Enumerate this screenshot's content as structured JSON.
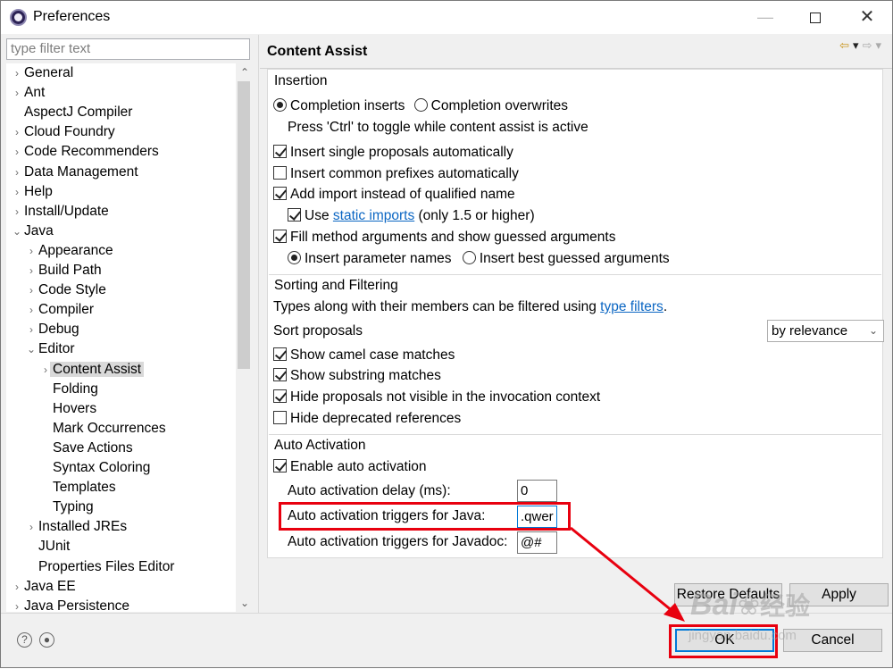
{
  "window": {
    "title": "Preferences"
  },
  "left": {
    "filter_placeholder": "type filter text",
    "tree": [
      {
        "label": "General",
        "twisty": "›"
      },
      {
        "label": "Ant",
        "twisty": "›"
      },
      {
        "label": "AspectJ Compiler",
        "twisty": ""
      },
      {
        "label": "Cloud Foundry",
        "twisty": "›"
      },
      {
        "label": "Code Recommenders",
        "twisty": "›"
      },
      {
        "label": "Data Management",
        "twisty": "›"
      },
      {
        "label": "Help",
        "twisty": "›"
      },
      {
        "label": "Install/Update",
        "twisty": "›"
      },
      {
        "label": "Java",
        "twisty": "⌄"
      },
      {
        "label": "Appearance",
        "twisty": "›"
      },
      {
        "label": "Build Path",
        "twisty": "›"
      },
      {
        "label": "Code Style",
        "twisty": "›"
      },
      {
        "label": "Compiler",
        "twisty": "›"
      },
      {
        "label": "Debug",
        "twisty": "›"
      },
      {
        "label": "Editor",
        "twisty": "⌄"
      },
      {
        "label": "Content Assist",
        "twisty": "›"
      },
      {
        "label": "Folding",
        "twisty": ""
      },
      {
        "label": "Hovers",
        "twisty": ""
      },
      {
        "label": "Mark Occurrences",
        "twisty": ""
      },
      {
        "label": "Save Actions",
        "twisty": ""
      },
      {
        "label": "Syntax Coloring",
        "twisty": ""
      },
      {
        "label": "Templates",
        "twisty": ""
      },
      {
        "label": "Typing",
        "twisty": ""
      },
      {
        "label": "Installed JREs",
        "twisty": "›"
      },
      {
        "label": "JUnit",
        "twisty": ""
      },
      {
        "label": "Properties Files Editor",
        "twisty": ""
      },
      {
        "label": "Java EE",
        "twisty": "›"
      },
      {
        "label": "Java Persistence",
        "twisty": "›"
      }
    ]
  },
  "page": {
    "title": "Content Assist",
    "insertion": {
      "title": "Insertion",
      "completion_inserts": "Completion inserts",
      "completion_overwrites": "Completion overwrites",
      "toggle_hint": "Press 'Ctrl' to toggle while content assist is active",
      "single_proposals": "Insert single proposals automatically",
      "common_prefixes": "Insert common prefixes automatically",
      "add_import": "Add import instead of qualified name",
      "use": "Use",
      "static_imports": "static imports",
      "only_15": "(only 1.5 or higher)",
      "fill_args": "Fill method arguments and show guessed arguments",
      "param_names": "Insert parameter names",
      "best_guessed": "Insert best guessed arguments"
    },
    "sorting": {
      "title": "Sorting and Filtering",
      "types_text": "Types along with their members can be filtered using",
      "type_filters": "type filters",
      "period": ".",
      "sort_label": "Sort proposals",
      "sort_value": "by relevance",
      "camel_case": "Show camel case matches",
      "substring": "Show substring matches",
      "hide_not_visible": "Hide proposals not visible in the invocation context",
      "hide_deprecated": "Hide deprecated references"
    },
    "auto": {
      "title": "Auto Activation",
      "enable": "Enable auto activation",
      "delay_label": "Auto activation delay (ms):",
      "delay_value": "0",
      "java_label": "Auto activation triggers for Java:",
      "java_value": ".qwer",
      "javadoc_label": "Auto activation triggers for Javadoc:",
      "javadoc_value": "@#"
    },
    "restore_defaults": "Restore Defaults",
    "apply": "Apply"
  },
  "footer": {
    "ok": "OK",
    "cancel": "Cancel"
  },
  "watermark": {
    "brand": "Bai",
    "cn": "经验",
    "url": "jingyan.baidu.com"
  },
  "colors": {
    "annotation": "#e8000f",
    "link": "#0b66c3",
    "focus": "#0078d7"
  },
  "icons": [
    "help-icon",
    "record-icon",
    "back-arrow-icon",
    "forward-arrow-icon",
    "chevron-down-icon"
  ]
}
